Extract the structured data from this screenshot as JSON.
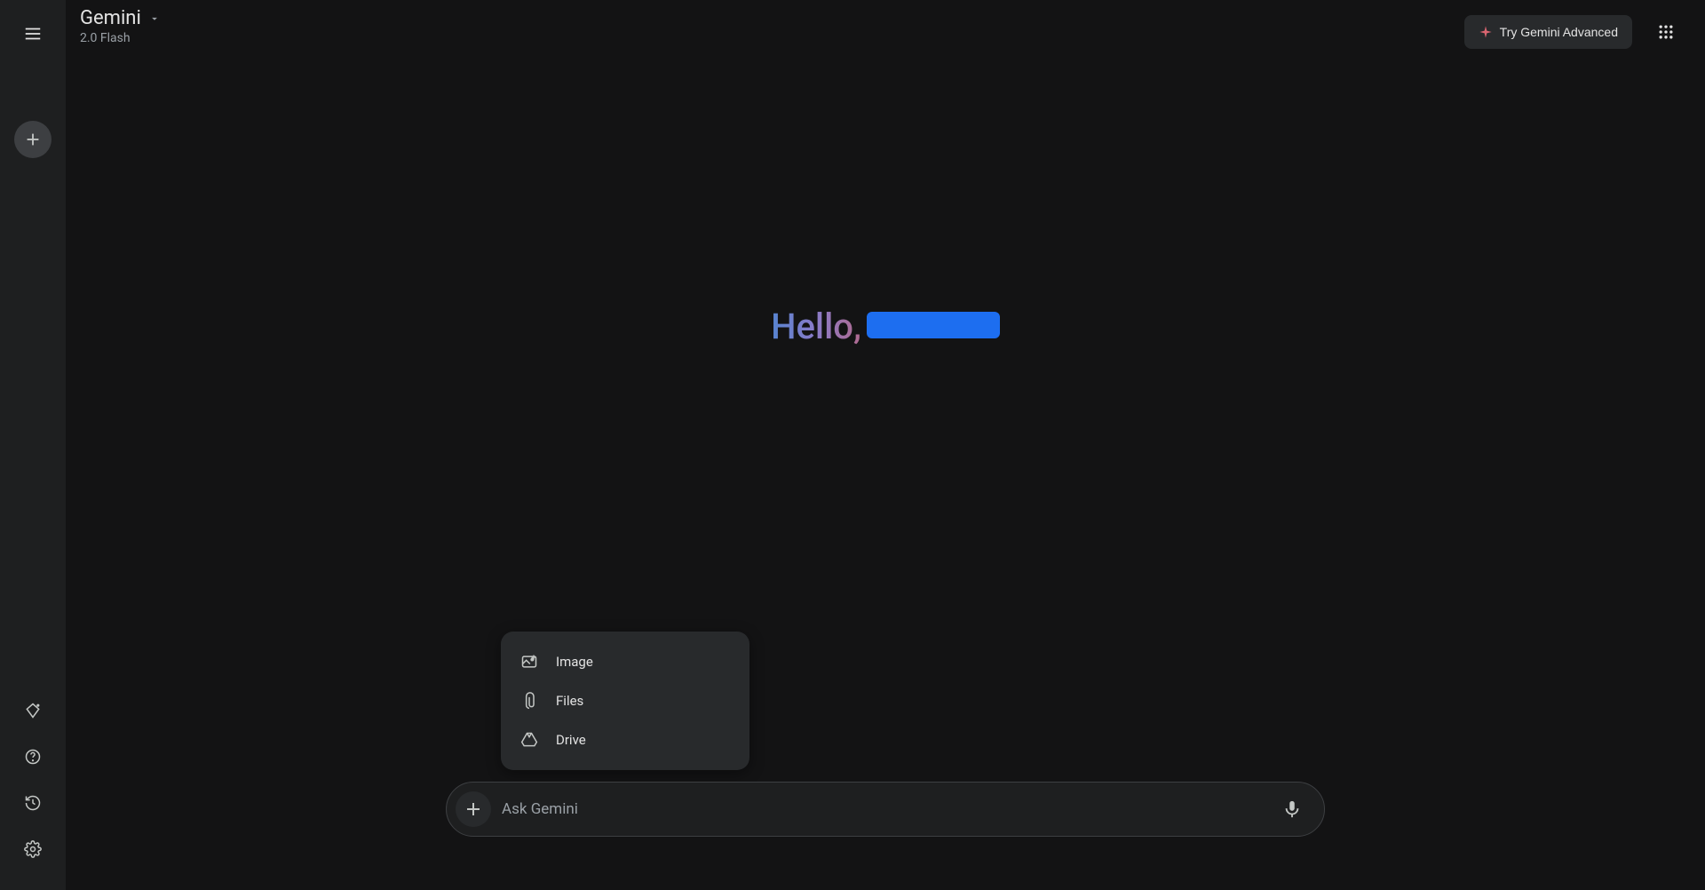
{
  "header": {
    "app_title": "Gemini",
    "model_name": "2.0 Flash",
    "try_advanced_label": "Try Gemini Advanced"
  },
  "greeting": {
    "text": "Hello,"
  },
  "attach_menu": {
    "items": [
      {
        "label": "Image"
      },
      {
        "label": "Files"
      },
      {
        "label": "Drive"
      }
    ]
  },
  "input": {
    "placeholder": "Ask Gemini"
  }
}
